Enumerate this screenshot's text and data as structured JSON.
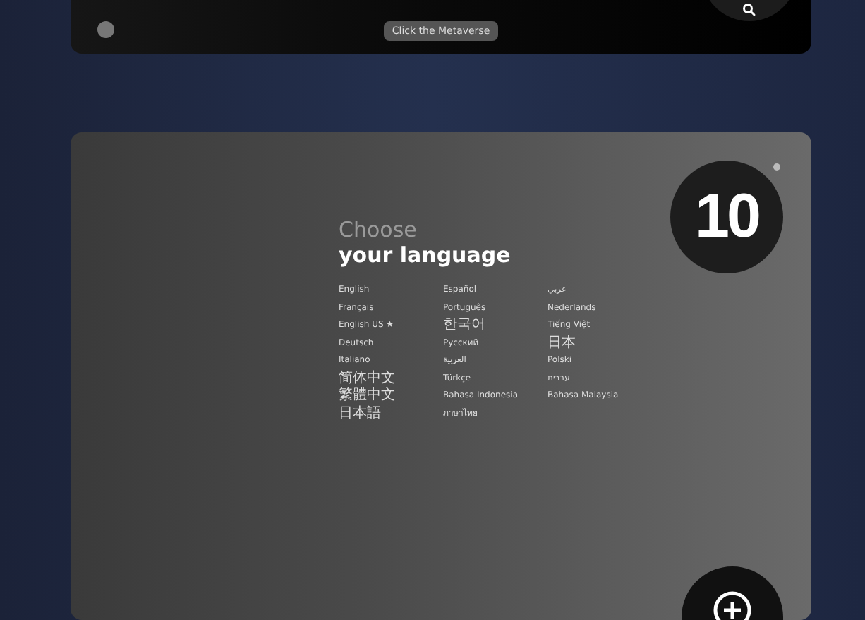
{
  "top_card": {
    "caption": "Click the Metaverse"
  },
  "language_card": {
    "heading_light": "Choose",
    "heading_bold": "your language",
    "badge": "10",
    "columns": [
      [
        {
          "label": "English",
          "kind": "latin"
        },
        {
          "label": "Français",
          "kind": "latin"
        },
        {
          "label": "English US ★",
          "kind": "latin"
        },
        {
          "label": "Deutsch",
          "kind": "latin"
        },
        {
          "label": "Italiano",
          "kind": "latin"
        },
        {
          "label": "简体中文",
          "kind": "cjk"
        },
        {
          "label": "繁體中文",
          "kind": "cjk"
        },
        {
          "label": "日本語",
          "kind": "cjk"
        }
      ],
      [
        {
          "label": "Español",
          "kind": "latin"
        },
        {
          "label": "Português",
          "kind": "latin"
        },
        {
          "label": "한국어",
          "kind": "cjk"
        },
        {
          "label": "Pусский",
          "kind": "latin"
        },
        {
          "label": "العربية",
          "kind": "latin"
        },
        {
          "label": "Türkçe",
          "kind": "latin"
        },
        {
          "label": "Bahasa Indonesia",
          "kind": "latin"
        },
        {
          "label": "ภาษาไทย",
          "kind": "latin"
        }
      ],
      [
        {
          "label": "عربي",
          "kind": "latin"
        },
        {
          "label": "Nederlands",
          "kind": "latin"
        },
        {
          "label": "Tiếng Việt",
          "kind": "latin"
        },
        {
          "label": "日本",
          "kind": "cjk"
        },
        {
          "label": "Polski",
          "kind": "latin"
        },
        {
          "label": "עברית",
          "kind": "latin"
        },
        {
          "label": "Bahasa Malaysia",
          "kind": "latin"
        }
      ]
    ]
  }
}
